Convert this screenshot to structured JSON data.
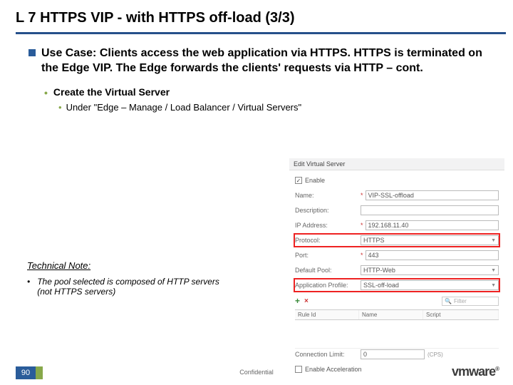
{
  "title": "L 7 HTTPS VIP - with HTTPS off-load (3/3)",
  "useCase": "Use Case: Clients access the web application via HTTPS. HTTPS is terminated on the Edge VIP. The Edge forwards the clients' requests via HTTP – cont.",
  "sub1": "Create the Virtual Server",
  "sub2": "Under \"Edge – Manage /  Load Balancer / Virtual Servers\"",
  "techNoteLabel": "Technical Note:",
  "techNoteText": "The pool selected is composed of HTTP servers (not HTTPS servers)",
  "dialog": {
    "title": "Edit Virtual Server",
    "enableLabel": "Enable",
    "enableChecked": true,
    "fields": {
      "name": {
        "label": "Name:",
        "value": "VIP-SSL-offload",
        "required": true
      },
      "description": {
        "label": "Description:",
        "value": ""
      },
      "ip": {
        "label": "IP Address:",
        "value": "192.168.11.40",
        "required": true
      },
      "protocol": {
        "label": "Protocol:",
        "value": "HTTPS",
        "highlight": true
      },
      "port": {
        "label": "Port:",
        "value": "443",
        "required": true
      },
      "pool": {
        "label": "Default Pool:",
        "value": "HTTP-Web"
      },
      "appProfile": {
        "label": "Application Profile:",
        "value": "SSL-off-load",
        "highlight": true
      }
    },
    "toolbar": {
      "filterPlaceholder": "Filter"
    },
    "gridHeaders": {
      "c1": "Rule Id",
      "c2": "Name",
      "c3": "Script"
    },
    "connLimit": {
      "label": "Connection Limit:",
      "value": "0",
      "suffix": "(CPS)"
    },
    "accel": {
      "label": "Enable Acceleration"
    }
  },
  "footer": {
    "page": "90",
    "confidential": "Confidential",
    "logo": "vmware"
  }
}
